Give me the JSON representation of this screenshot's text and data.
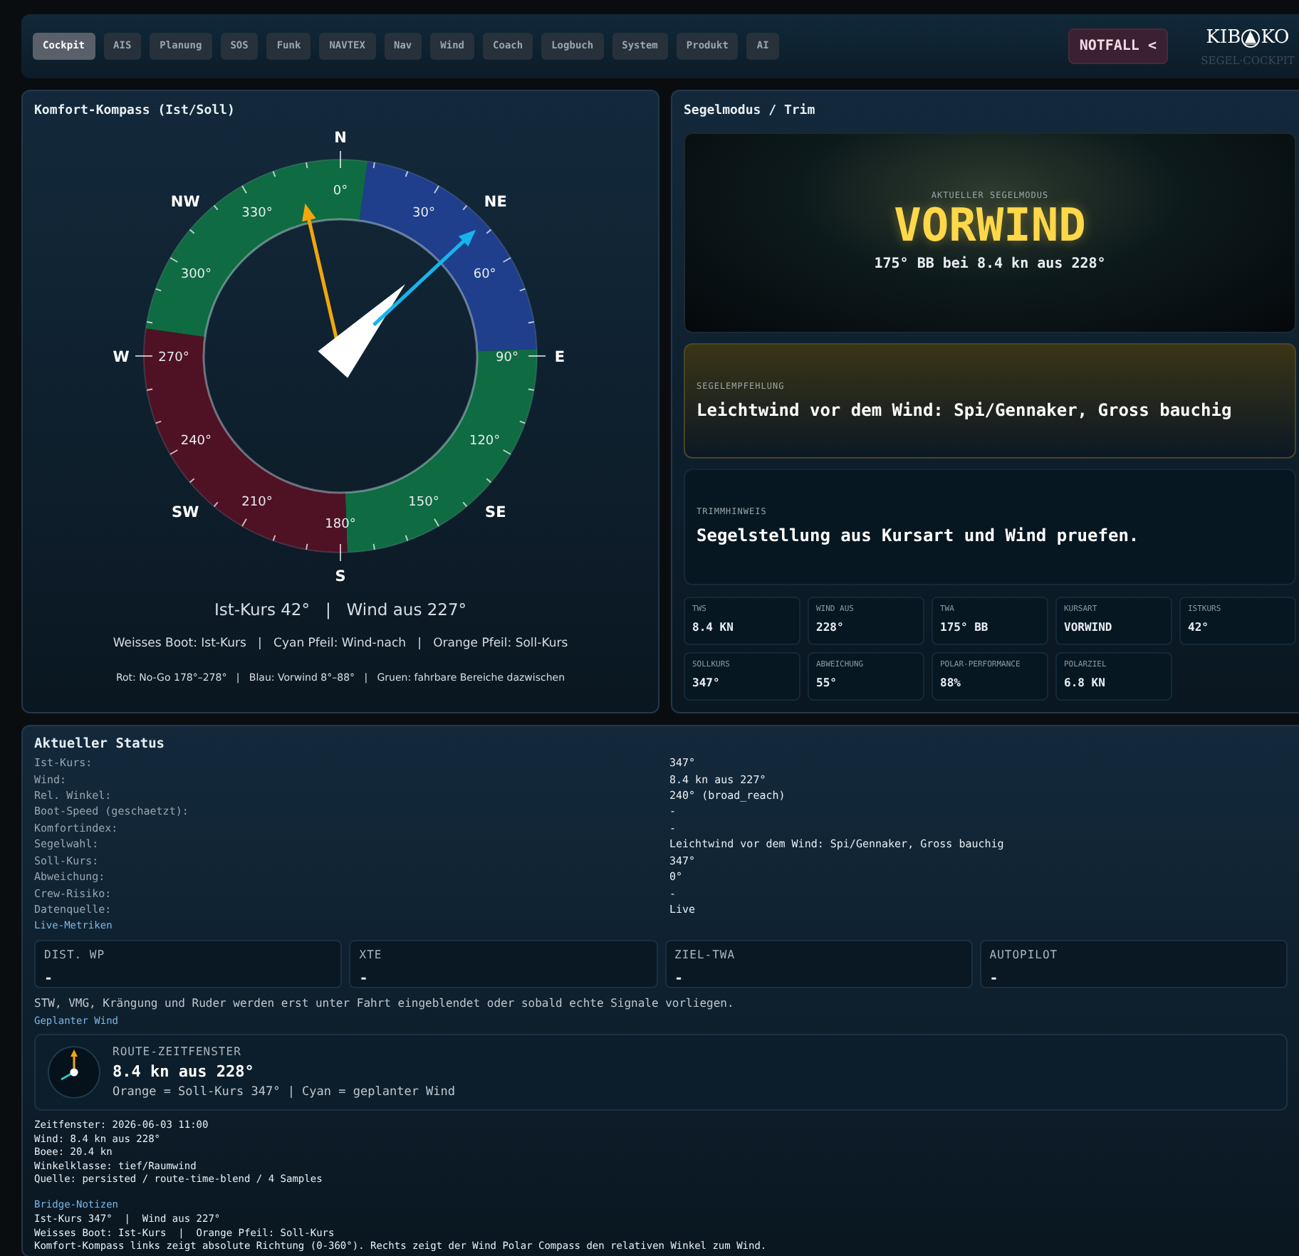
{
  "nav": {
    "tabs": [
      {
        "label": "Cockpit",
        "selected": true
      },
      {
        "label": "AIS",
        "selected": false
      },
      {
        "label": "Planung",
        "selected": false
      },
      {
        "label": "SOS",
        "selected": false
      },
      {
        "label": "Funk",
        "selected": false
      },
      {
        "label": "NAVTEX",
        "selected": false
      },
      {
        "label": "Nav",
        "selected": false
      },
      {
        "label": "Wind",
        "selected": false
      },
      {
        "label": "Coach",
        "selected": false
      },
      {
        "label": "Logbuch",
        "selected": false
      },
      {
        "label": "System",
        "selected": false
      },
      {
        "label": "Produkt",
        "selected": false
      },
      {
        "label": "AI",
        "selected": false
      }
    ],
    "emergency_button": "NOTFALL <",
    "logo": {
      "left": "KIB",
      "right": "KO",
      "subtitle": "SEGEL·COCKPIT"
    }
  },
  "compass_panel": {
    "title": "Komfort-Kompass (Ist/Soll)",
    "cardinals": [
      "N",
      "NE",
      "E",
      "SE",
      "S",
      "SW",
      "W",
      "NW"
    ],
    "degrees": [
      "0°",
      "30°",
      "60°",
      "90°",
      "120°",
      "150°",
      "180°",
      "210°",
      "240°",
      "270°",
      "300°",
      "330°"
    ],
    "sectors": [
      {
        "color": "#0f6b42"
      },
      {
        "color": "#1f3f8c"
      },
      {
        "color": "#0f6b42"
      },
      {
        "color": "#4e1224"
      }
    ],
    "summary": "Ist-Kurs 42°   |   Wind aus 227°",
    "legend": "Weisses Boot: Ist-Kurs   |   Cyan Pfeil: Wind-nach   |   Orange Pfeil: Soll-Kurs",
    "zones_note": "Rot: No-Go 178°–278°   |   Blau: Vorwind 8°–88°   |   Gruen: fahrbare Bereiche dazwischen"
  },
  "trim_panel": {
    "title": "Segelmodus / Trim",
    "mode": {
      "label": "AKTUELLER SEGELMODUS",
      "value": "VORWIND",
      "detail": "175° BB bei 8.4 kn aus 228°"
    },
    "recommendation": {
      "label": "SEGELEMPFEHLUNG",
      "text": "Leichtwind vor dem Wind: Spi/Gennaker, Gross bauchig"
    },
    "trim_hint": {
      "label": "TRIMMHINWEIS",
      "text": "Segelstellung aus Kursart und Wind pruefen."
    },
    "metrics": [
      {
        "label": "TWS",
        "value": "8.4 KN"
      },
      {
        "label": "WIND AUS",
        "value": "228°"
      },
      {
        "label": "TWA",
        "value": "175° BB"
      },
      {
        "label": "KURSART",
        "value": "VORWIND"
      },
      {
        "label": "ISTKURS",
        "value": "42°"
      },
      {
        "label": "SOLLKURS",
        "value": "347°"
      },
      {
        "label": "ABWEICHUNG",
        "value": "55°"
      },
      {
        "label": "POLAR-PERFORMANCE",
        "value": "88%"
      },
      {
        "label": "POLARZIEL",
        "value": "6.8 KN"
      }
    ]
  },
  "status_panel": {
    "title": "Aktueller Status",
    "rows": [
      {
        "label": "Ist-Kurs:",
        "value": "347°"
      },
      {
        "label": "Wind:",
        "value": "8.4 kn aus 227°"
      },
      {
        "label": "Rel. Winkel:",
        "value": "240° (broad_reach)"
      },
      {
        "label": "Boot-Speed (geschaetzt):",
        "value": "-"
      },
      {
        "label": "Komfortindex:",
        "value": "-"
      },
      {
        "label": "Segelwahl:",
        "value": "Leichtwind vor dem Wind: Spi/Gennaker, Gross bauchig"
      },
      {
        "label": "Soll-Kurs:",
        "value": "347°"
      },
      {
        "label": "Abweichung:",
        "value": "0°"
      },
      {
        "label": "Crew-Risiko:",
        "value": "-"
      },
      {
        "label": "Datenquelle:",
        "value": "Live"
      }
    ],
    "live_heading": "Live-Metriken",
    "live_metrics": [
      {
        "label": "DIST. WP",
        "value": "-"
      },
      {
        "label": "XTE",
        "value": "-"
      },
      {
        "label": "ZIEL-TWA",
        "value": "-"
      },
      {
        "label": "AUTOPILOT",
        "value": "-"
      }
    ],
    "live_note": "STW, VMG, Krängung und Ruder werden erst unter Fahrt eingeblendet oder sobald echte Signale vorliegen.",
    "planned_heading": "Geplanter Wind",
    "route_card": {
      "label": "ROUTE-ZEITFENSTER",
      "value": "8.4 kn aus 228°",
      "note": "Orange = Soll-Kurs 347° | Cyan = geplanter Wind"
    },
    "details": [
      "Zeitfenster: 2026-06-03 11:00",
      "Wind: 8.4 kn aus 228°",
      "Boee: 20.4 kn",
      "Winkelklasse: tief/Raumwind",
      "Quelle: persisted / route-time-blend / 4 Samples"
    ],
    "notes_heading": "Bridge-Notizen",
    "notes": [
      "Ist-Kurs 347°  |  Wind aus 227°",
      "Weisses Boot: Ist-Kurs  |  Orange Pfeil: Soll-Kurs",
      "Komfort-Kompass links zeigt absolute Richtung (0-360°). Rechts zeigt der Wind Polar Compass den relativen Winkel zum Wind."
    ]
  }
}
